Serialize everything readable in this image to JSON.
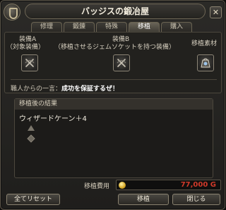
{
  "window": {
    "title": "バッジスの鍛冶屋",
    "close_glyph": "✕"
  },
  "tabs": [
    {
      "label": "修理",
      "active": false
    },
    {
      "label": "鍛錬",
      "active": false
    },
    {
      "label": "特殊",
      "active": false
    },
    {
      "label": "移植",
      "active": true
    },
    {
      "label": "購入",
      "active": false
    }
  ],
  "slots": {
    "equip_a": {
      "label": "装備A",
      "sublabel": "（対象装備）",
      "icon": "empty-slot-crossed-icon"
    },
    "equip_b": {
      "label": "装備B",
      "sublabel": "（移植させるジェムソケットを持つ装備）",
      "icon": "empty-slot-crossed-icon"
    },
    "material": {
      "label": "移植素材",
      "icon": "material-bag-icon"
    }
  },
  "craftsman": {
    "label": "職人からの一言：",
    "message": "成功を保証するぜ！"
  },
  "result": {
    "header": "移植後の結果",
    "item_name": "ウィザードケーン＋4",
    "icons": [
      "up-arrow-icon",
      "diamond-icon"
    ]
  },
  "cost": {
    "label": "移植費用",
    "value": "77,000 G",
    "value_color": "#d13a2a"
  },
  "buttons": {
    "reset": "全てリセット",
    "transplant": "移植",
    "close": "閉じる"
  },
  "colors": {
    "accent": "#8a8270",
    "panel": "#22211e",
    "background": "#2b2a27"
  }
}
